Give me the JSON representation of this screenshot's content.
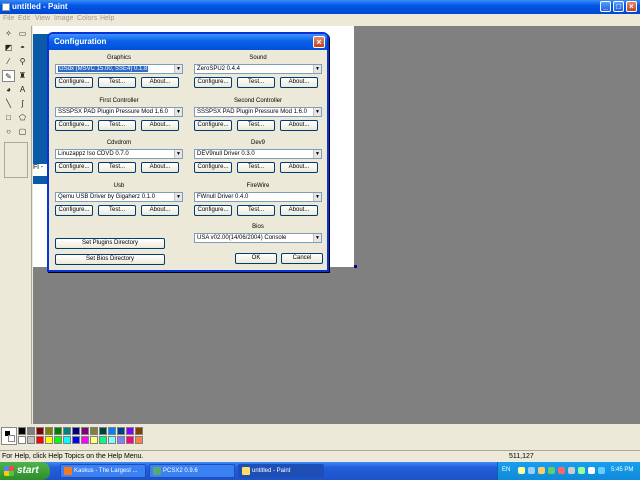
{
  "paint": {
    "title": "untitled - Paint",
    "menu": [
      "File",
      "Edit",
      "View",
      "Image",
      "Colors",
      "Help"
    ],
    "status_help": "For Help, click Help Topics on the Help Menu.",
    "coords": "511,127",
    "canvas_fragment_text": "Fl -"
  },
  "dialog": {
    "title": "Configuration",
    "sections": [
      {
        "label": "Graphics",
        "value": "GSdx (MSVC 15.00, SSE4) 0.1.8",
        "selected": true
      },
      {
        "label": "Sound",
        "value": "ZeroSPU2 0.4.4"
      },
      {
        "label": "First Controller",
        "value": "SSSPSX PAD Plugin Pressure Mod 1.6.0"
      },
      {
        "label": "Second Controller",
        "value": "SSSPSX PAD Plugin Pressure Mod 1.6.0"
      },
      {
        "label": "Cdvdrom",
        "value": "Linuzappz Iso CDVD 0.7.0"
      },
      {
        "label": "Dev9",
        "value": "DEV9null Driver 0.3.0"
      },
      {
        "label": "Usb",
        "value": "Qemu USB Driver by Gigaherz 0.1.0"
      },
      {
        "label": "FireWire",
        "value": "FWnull Driver 0.4.0"
      }
    ],
    "configure_label": "Configure...",
    "test_label": "Test...",
    "about_label": "About...",
    "bios_label": "Bios",
    "bios_value": "USA   v02.00(14/06/2004) Console",
    "plugins_dir_label": "Set Plugins Directory",
    "bios_dir_label": "Set Bios Directory",
    "ok_label": "OK",
    "cancel_label": "Cancel",
    "close_glyph": "×",
    "arrow_glyph": "▼"
  },
  "taskbar": {
    "start_label": "start",
    "tasks": [
      {
        "label": "Kaskus - The Largest ..."
      },
      {
        "label": "PCSX2 0.9.6"
      },
      {
        "label": "untitled - Paint",
        "active": true
      }
    ],
    "lang": "EN",
    "clock": "5:45 PM"
  },
  "colors": {
    "palette_top": [
      "#000000",
      "#808080",
      "#800000",
      "#808000",
      "#008000",
      "#008080",
      "#000080",
      "#800080",
      "#808040",
      "#004040",
      "#0080ff",
      "#004080",
      "#8000ff",
      "#804000"
    ],
    "palette_bottom": [
      "#ffffff",
      "#c0c0c0",
      "#ff0000",
      "#ffff00",
      "#00ff00",
      "#00ffff",
      "#0000ff",
      "#ff00ff",
      "#ffff80",
      "#00ff80",
      "#80ffff",
      "#8080ff",
      "#ff0080",
      "#ff8040"
    ]
  },
  "icons": [
    "pencil-icon",
    "brush-icon",
    "fill-icon",
    "magnifier-icon",
    "eraser-icon",
    "text-icon",
    "line-icon",
    "curve-icon",
    "rectangle-icon",
    "ellipse-icon",
    "close-icon",
    "dropdown-arrow-icon",
    "windows-flag-icon"
  ]
}
